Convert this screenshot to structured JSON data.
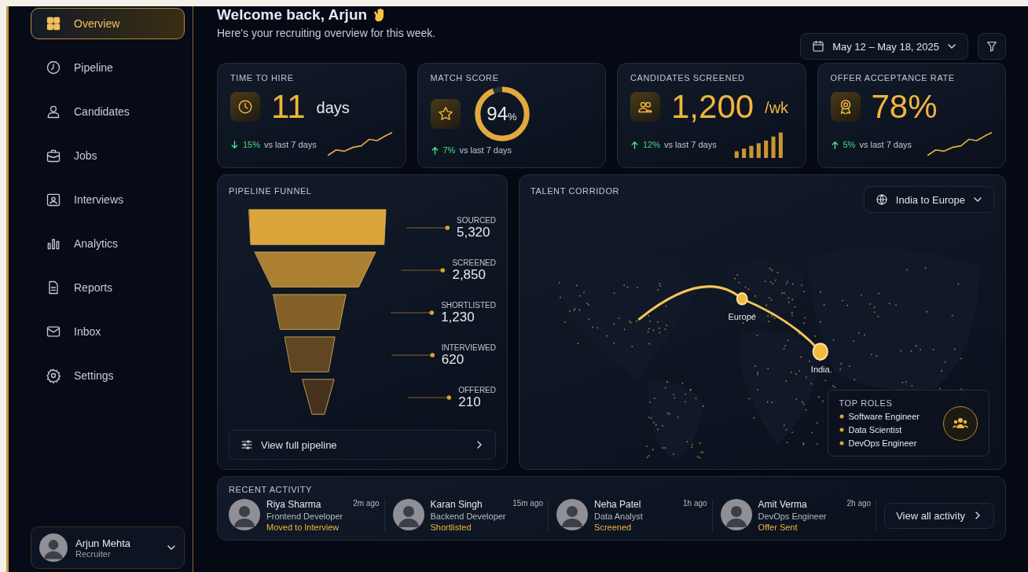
{
  "sidebar": {
    "items": [
      {
        "label": "Overview",
        "selected": true
      },
      {
        "label": "Pipeline",
        "selected": false
      },
      {
        "label": "Candidates",
        "selected": false
      },
      {
        "label": "Jobs",
        "selected": false
      },
      {
        "label": "Interviews",
        "selected": false
      },
      {
        "label": "Analytics",
        "selected": false
      },
      {
        "label": "Reports",
        "selected": false
      },
      {
        "label": "Inbox",
        "selected": false
      },
      {
        "label": "Settings",
        "selected": false
      }
    ],
    "user": {
      "name": "Arjun Mehta",
      "role": "Recruiter"
    }
  },
  "header": {
    "title": "Welcome back, Arjun",
    "subtitle": "Here's your recruiting overview for this week.",
    "date_range": "May 12 – May 18, 2025"
  },
  "kpis": [
    {
      "kind": "line",
      "title": "TIME TO HIRE",
      "value": "11",
      "unit": "days",
      "falling": true,
      "change": "15%",
      "period": "vs last 7 days"
    },
    {
      "kind": "ring",
      "title": "MATCH SCORE",
      "value": "94",
      "unit": "%",
      "level": 0.94,
      "falling": false,
      "change": "7%",
      "period": "vs last 7 days"
    },
    {
      "kind": "bars",
      "title": "CANDIDATES SCREENED",
      "value": "1,200",
      "unit": "/wk",
      "falling": false,
      "change": "12%",
      "period": "vs last 7 days"
    },
    {
      "kind": "line",
      "title": "OFFER ACCEPTANCE RATE",
      "value": "78%",
      "falling": false,
      "change": "5%",
      "period": "vs last 7 days"
    }
  ],
  "funnel": {
    "title": "PIPELINE FUNNEL",
    "stages": [
      {
        "label": "SOURCED",
        "value": "5,320"
      },
      {
        "label": "SCREENED",
        "value": "2,850"
      },
      {
        "label": "SHORTLISTED",
        "value": "1,230"
      },
      {
        "label": "INTERVIEWED",
        "value": "620"
      },
      {
        "label": "OFFERED",
        "value": "210"
      }
    ],
    "button": "View full pipeline"
  },
  "corridor": {
    "title": "TALENT CORRIDOR",
    "region": "India to Europe",
    "markers": [
      {
        "label": "Europe"
      },
      {
        "label": "India"
      }
    ],
    "top_roles": {
      "title": "TOP ROLES",
      "items": [
        "Software Engineer",
        "Data Scientist",
        "DevOps Engineer"
      ]
    }
  },
  "activity": {
    "title": "RECENT ACTIVITY",
    "items": [
      {
        "name": "Riya Sharma",
        "role": "Frontend Developer",
        "time": "2m ago",
        "status": "Moved to Interview"
      },
      {
        "name": "Karan Singh",
        "role": "Backend Developer",
        "time": "15m ago",
        "status": "Shortlisted"
      },
      {
        "name": "Neha Patel",
        "role": "Data Analyst",
        "time": "1h ago",
        "status": "Screened"
      },
      {
        "name": "Amit Verma",
        "role": "DevOps Engineer",
        "time": "2h ago",
        "status": "Offer Sent"
      }
    ],
    "button": "View all activity"
  }
}
